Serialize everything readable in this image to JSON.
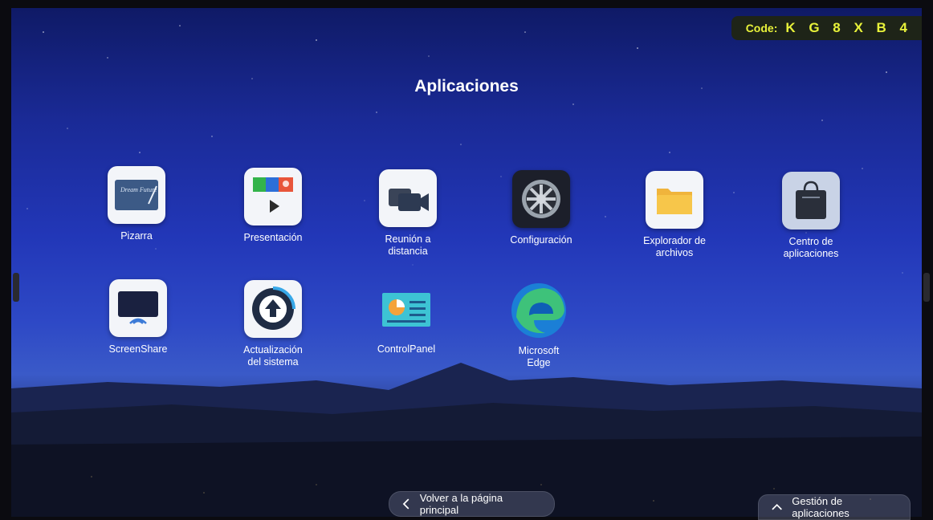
{
  "header": {
    "code_label": "Code:",
    "code_value": "K G 8 X B 4",
    "badge_text_color": "#e8f23a"
  },
  "page": {
    "title": "Aplicaciones"
  },
  "apps": [
    {
      "label_line1": "Pizarra",
      "label_line2": "",
      "icon": "whiteboard-icon",
      "tile_text": "Dream Future"
    },
    {
      "label_line1": "Presentación",
      "label_line2": "",
      "icon": "presentation-icon"
    },
    {
      "label_line1": "Reunión a",
      "label_line2": "distancia",
      "icon": "video-meeting-icon"
    },
    {
      "label_line1": "Configuración",
      "label_line2": "",
      "icon": "settings-wheel-icon"
    },
    {
      "label_line1": "Explorador de",
      "label_line2": "archivos",
      "icon": "folder-icon"
    },
    {
      "label_line1": "Centro de",
      "label_line2": "aplicaciones",
      "icon": "app-store-bag-icon"
    },
    {
      "label_line1": "ScreenShare",
      "label_line2": "",
      "icon": "screenshare-icon"
    },
    {
      "label_line1": "Actualización",
      "label_line2": "del sistema",
      "icon": "system-update-icon"
    },
    {
      "label_line1": "ControlPanel",
      "label_line2": "",
      "icon": "control-panel-icon"
    },
    {
      "label_line1": "Microsoft",
      "label_line2": "Edge",
      "icon": "edge-browser-icon"
    }
  ],
  "footer": {
    "back_label": "Volver a la página principal",
    "manage_label": "Gestión de aplicaciones"
  }
}
